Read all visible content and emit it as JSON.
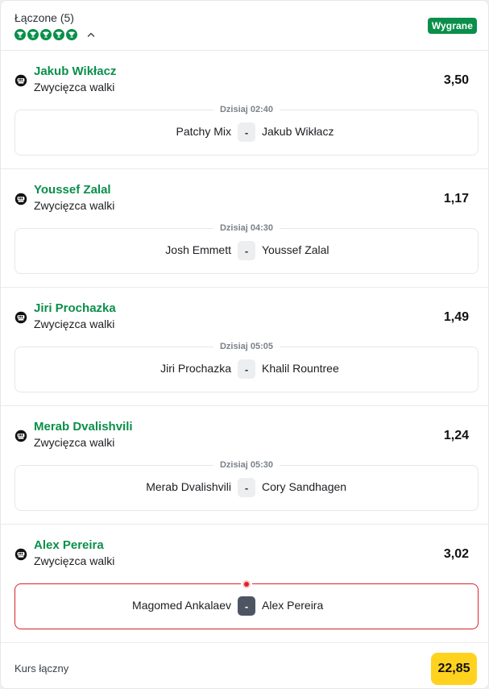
{
  "header": {
    "title": "Łączone (5)",
    "status": "Wygrane",
    "result_icons": [
      "trophy-icon",
      "trophy-icon",
      "trophy-icon",
      "trophy-icon",
      "trophy-icon"
    ],
    "collapse_icon": "chevron-up-icon"
  },
  "bets": [
    {
      "sport_icon": "mma-glove-icon",
      "selection": "Jakub Wikłacz",
      "market": "Zwycięzca walki",
      "odds": "3,50",
      "time": "Dzisiaj 02:40",
      "home": "Patchy Mix",
      "away": "Jakub Wikłacz",
      "score": "-",
      "live": false
    },
    {
      "sport_icon": "mma-glove-icon",
      "selection": "Youssef Zalal",
      "market": "Zwycięzca walki",
      "odds": "1,17",
      "time": "Dzisiaj 04:30",
      "home": "Josh Emmett",
      "away": "Youssef Zalal",
      "score": "-",
      "live": false
    },
    {
      "sport_icon": "mma-glove-icon",
      "selection": "Jiri Prochazka",
      "market": "Zwycięzca walki",
      "odds": "1,49",
      "time": "Dzisiaj 05:05",
      "home": "Jiri Prochazka",
      "away": "Khalil Rountree",
      "score": "-",
      "live": false
    },
    {
      "sport_icon": "mma-glove-icon",
      "selection": "Merab Dvalishvili",
      "market": "Zwycięzca walki",
      "odds": "1,24",
      "time": "Dzisiaj 05:30",
      "home": "Merab Dvalishvili",
      "away": "Cory Sandhagen",
      "score": "-",
      "live": false
    },
    {
      "sport_icon": "mma-glove-icon",
      "selection": "Alex Pereira",
      "market": "Zwycięzca walki",
      "odds": "3,02",
      "time": "",
      "home": "Magomed Ankalaev",
      "away": "Alex Pereira",
      "score": "-",
      "live": true
    }
  ],
  "footer": {
    "label": "Kurs łączny",
    "total_odds": "22,85"
  },
  "colors": {
    "win_green": "#0a8f4a",
    "live_red": "#d7232a",
    "total_yellow": "#ffd21f"
  }
}
